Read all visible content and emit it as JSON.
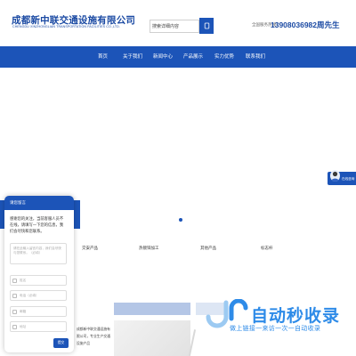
{
  "header": {
    "company_cn": "成都新中联交通设施有限公司",
    "company_en": "CHENGDU XINZHONGLIAN TRANSPORTATION FACILITIES CO.,LTD.",
    "search_placeholder": "搜索详细内容",
    "search_icon": "search-icon",
    "hotline_label": "全国服务热线：",
    "hotline_number": "13908036982周先生"
  },
  "nav": {
    "items": [
      {
        "label": "首页"
      },
      {
        "label": "关于我们"
      },
      {
        "label": "新闻中心"
      },
      {
        "label": "产品展示"
      },
      {
        "label": "实力优势"
      },
      {
        "label": "联系我们"
      }
    ]
  },
  "categories": {
    "items": [
      {
        "label": "交安产品"
      },
      {
        "label": "热镀锌加工"
      },
      {
        "label": "其他产品"
      },
      {
        "label": "标志杆"
      }
    ]
  },
  "service": {
    "label": "在线咨询"
  },
  "chat": {
    "title": "请您留言",
    "message": "感谢您的关注，当前客服人员不在线，请填写一下您的信息，我们会尽快和您联系。",
    "textarea_placeholder": "请在此输入留言内容，我们会尽快与您联系。（必填）",
    "fields": [
      {
        "placeholder": "姓名"
      },
      {
        "placeholder": "电话（必填）"
      },
      {
        "placeholder": "邮箱"
      },
      {
        "placeholder": "地址"
      }
    ],
    "submit_label": "提交"
  },
  "about": {
    "text": "成都新中联交通设施有限公司，专业生产交通设施产品"
  },
  "watermark": {
    "title": "自动秒收录",
    "subtitle": "做上链接一来访一次一自动收录"
  },
  "colors": {
    "brand": "#1c54b8",
    "watermark": "#2e8be8"
  }
}
